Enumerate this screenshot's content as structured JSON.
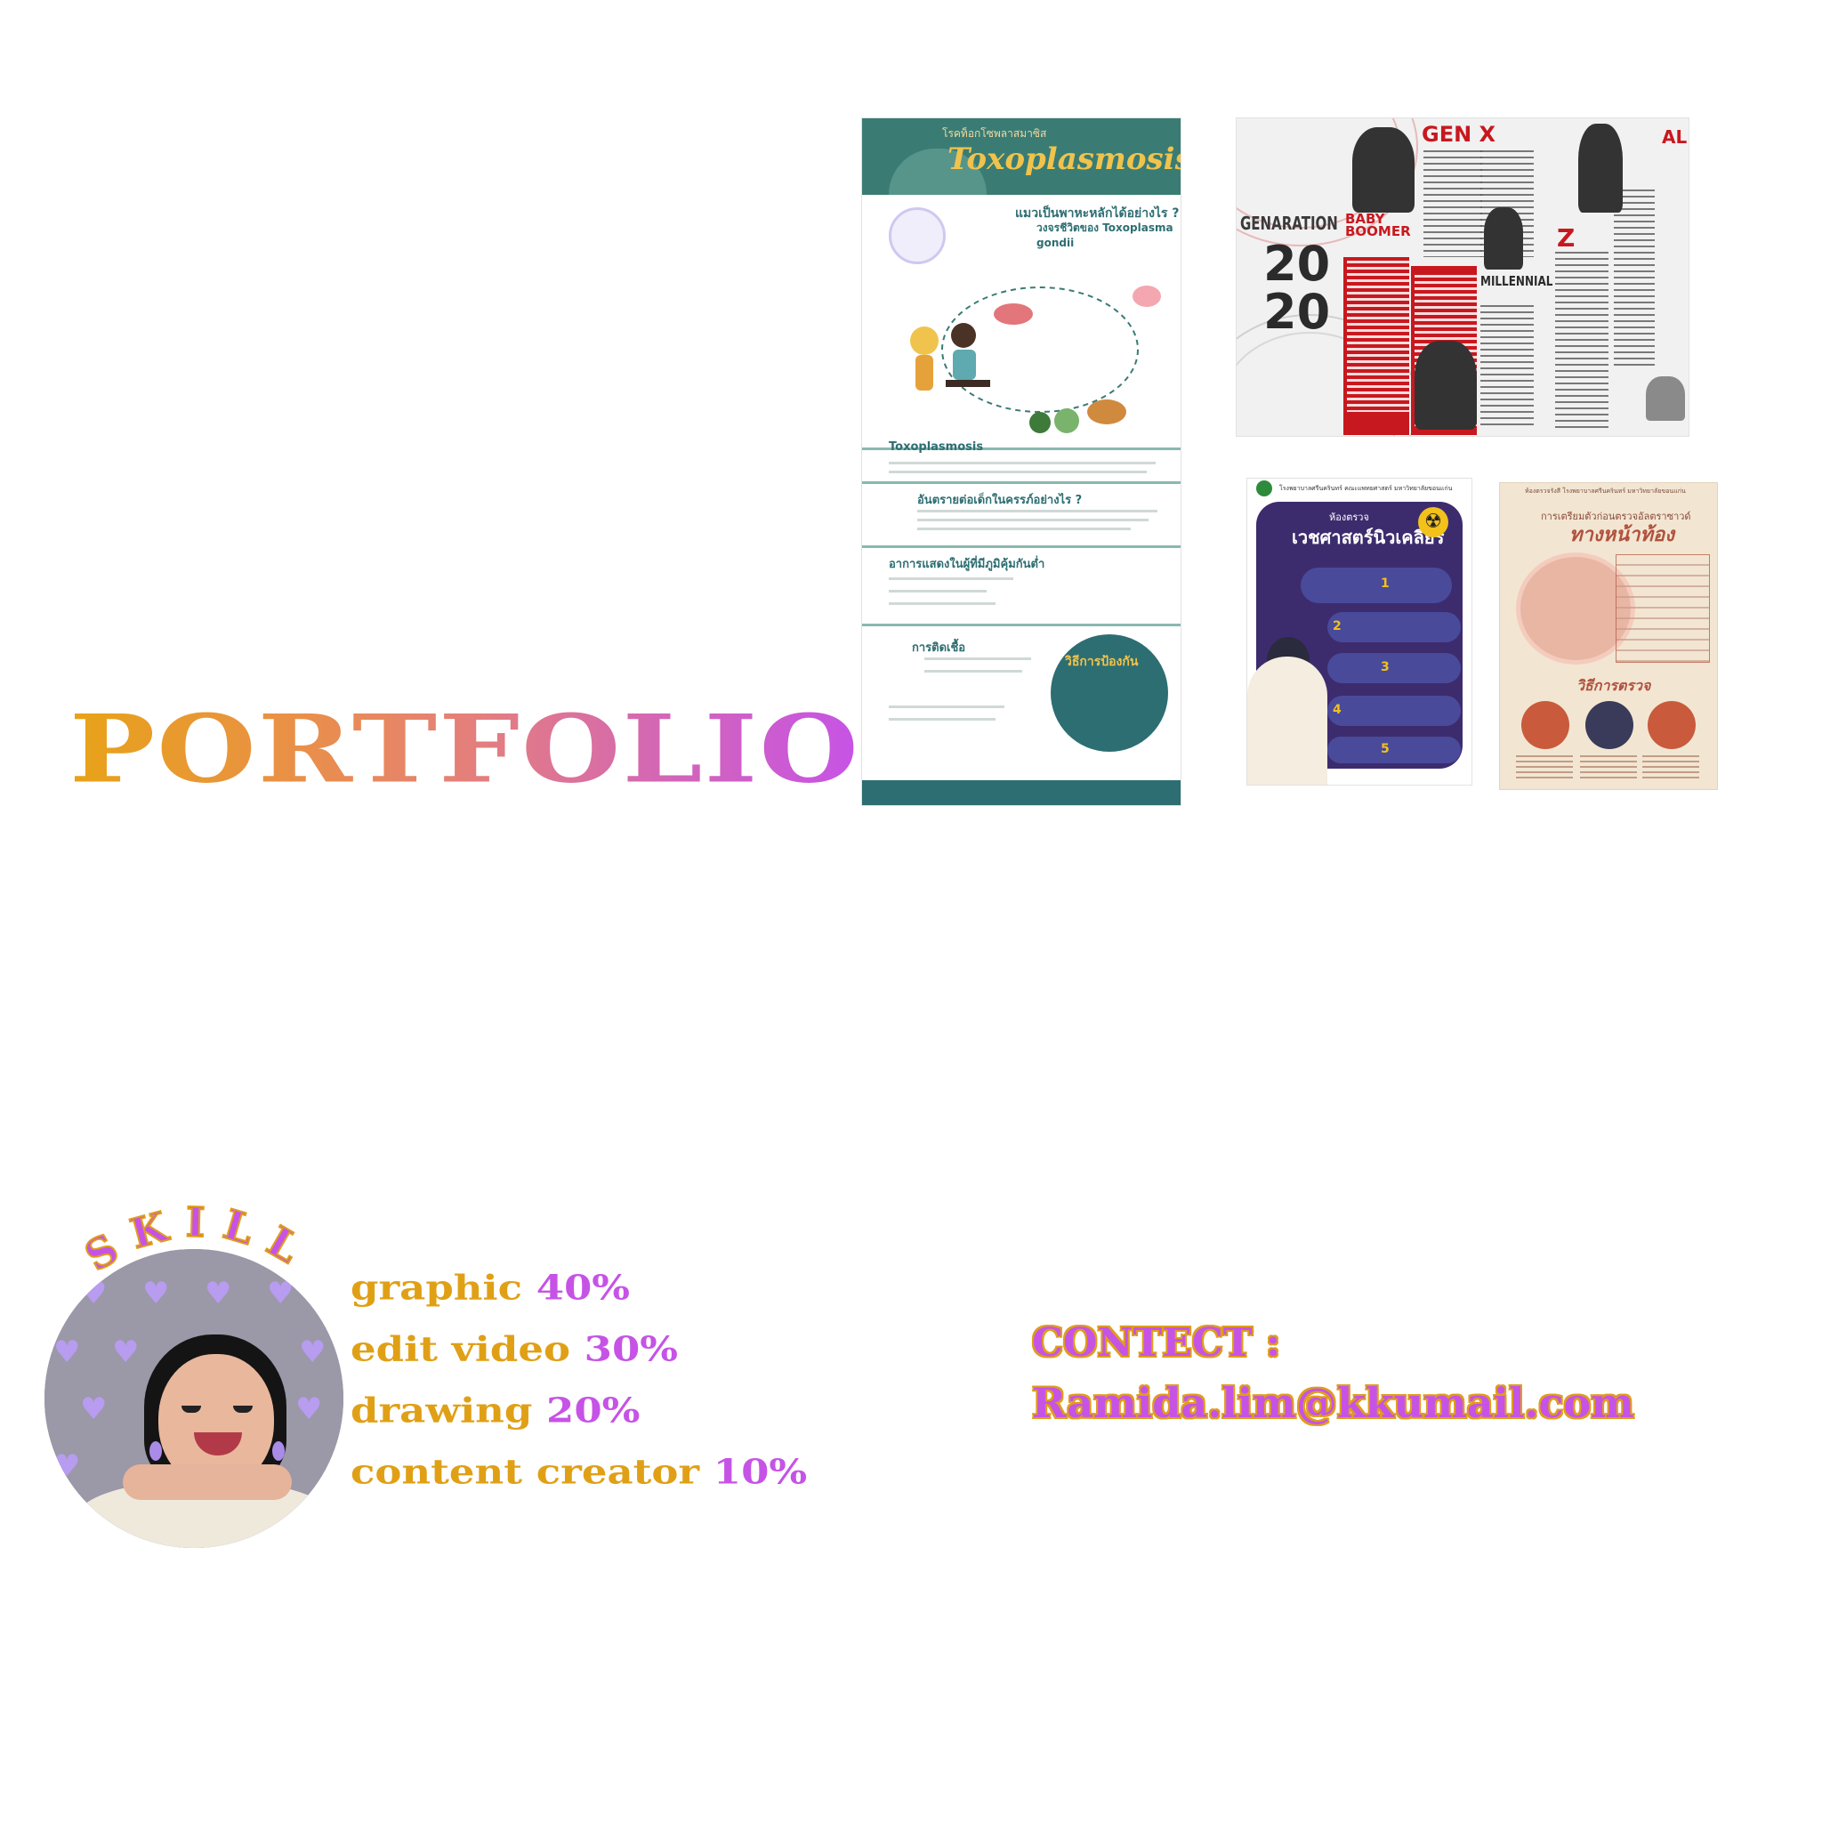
{
  "title": "PORTFOLIO",
  "portfolio_items": {
    "toxo": {
      "subtitle": "โรคท็อกโซพลาสมาซิส",
      "title": "Toxoplasmosis",
      "question": "แมวเป็นพาหะหลักได้อย่างไร ?",
      "question2": "วงจรชีวิตของ Toxoplasma gondii",
      "section1": "Toxoplasmosis",
      "section2": "อันตรายต่อเด็กในครรภ์อย่างไร ?",
      "section3": "อาการแสดงในผู้ที่มีภูมิคุ้มกันต่ำ",
      "section4": "การติดเชื้อ",
      "prevention": "วิธีการป้องกัน"
    },
    "generation": {
      "label": "GENARATION",
      "year_top": "20",
      "year_bottom": "20",
      "gen_x": "GEN X",
      "baby_boomer": "BABY BOOMER",
      "millennial": "MILLENNIAL",
      "gen_z": "Z",
      "alpha": "ALPHA"
    },
    "nuclear": {
      "header": "โรงพยาบาลศรีนครินทร์ คณะแพทยศาสตร์ มหาวิทยาลัยขอนแก่น",
      "room": "ห้องตรวจ",
      "title": "เวชศาสตร์นิวเคลียร์",
      "radiation_icon": "☢",
      "steps": [
        "1",
        "2",
        "3",
        "4",
        "5"
      ]
    },
    "ultrasound": {
      "header": "ห้องตรวจรังสี โรงพยาบาลศรีนครินทร์ มหาวิทยาลัยขอนแก่น",
      "subtitle": "การเตรียมตัวก่อนตรวจอัลตราซาวด์",
      "title": "ทางหน้าท้อง",
      "section": "วิธีการตรวจ"
    }
  },
  "skill": {
    "heading": "SKILL",
    "heart_icon": "heart-icon",
    "heart_glyph": "♥",
    "items": [
      {
        "name": "graphic",
        "percent": "40%",
        "value": 40
      },
      {
        "name": "edit video",
        "percent": "30%",
        "value": 30
      },
      {
        "name": "drawing",
        "percent": "20%",
        "value": 20
      },
      {
        "name": "content creator",
        "percent": "10%",
        "value": 10
      }
    ]
  },
  "contact": {
    "label": "CONTECT :",
    "email": "Ramida.lim@kkumail.com"
  },
  "colors": {
    "gold": "#e0a016",
    "purple": "#c653e6",
    "teal": "#2d6e72",
    "red": "#c8181f"
  }
}
